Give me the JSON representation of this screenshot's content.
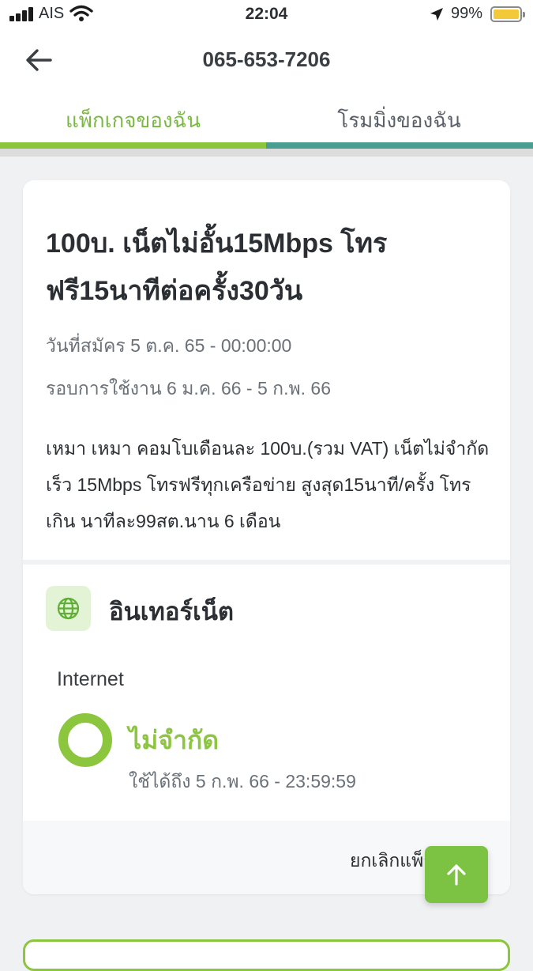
{
  "status_bar": {
    "carrier": "AIS",
    "time": "22:04",
    "battery_percent": "99%",
    "icons": [
      "signal-icon",
      "wifi-icon",
      "location-arrow-icon",
      "battery-icon"
    ]
  },
  "header": {
    "title": "065-653-7206",
    "back_icon": "arrow-left-icon"
  },
  "tabs": [
    {
      "label": "แพ็กเกจของฉัน",
      "active": true
    },
    {
      "label": "โรมมิ่งของฉัน",
      "active": false
    }
  ],
  "package": {
    "title": "100บ. เน็ตไม่อั้น15Mbps โทรฟรี15นาทีต่อครั้ง30วัน",
    "register_date": "วันที่สมัคร 5 ต.ค. 65 - 00:00:00",
    "usage_cycle": "รอบการใช้งาน 6 ม.ค. 66 - 5 ก.พ. 66",
    "description": "เหมา เหมา คอมโบเดือนละ 100บ.(รวม VAT) เน็ตไม่จำกัด เร็ว 15Mbps โทรฟรีทุกเครือข่าย สูงสุด15นาที/ครั้ง โทรเกิน นาทีละ99สต.นาน 6 เดือน",
    "section_title": "อินเทอร์เน็ต",
    "section_icon": "globe-icon",
    "internet_label": "Internet",
    "internet_quota": "ไม่จำกัด",
    "valid_until": "ใช้ได้ถึง 5 ก.พ. 66 - 23:59:59",
    "cancel_label": "ยกเลิกแพ็กเกจนี้"
  },
  "colors": {
    "accent_green": "#8cc63e",
    "teal": "#4a9e91",
    "fab_green": "#7cc243"
  },
  "fab_icon": "arrow-up-icon"
}
